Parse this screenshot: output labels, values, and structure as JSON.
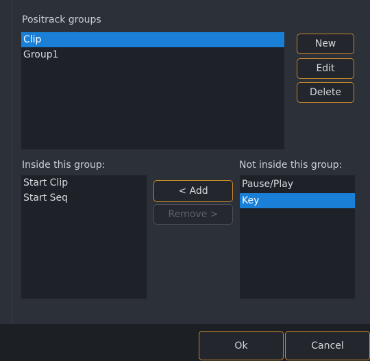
{
  "groups": {
    "label": "Positrack groups",
    "items": [
      "Clip",
      "Group1"
    ],
    "selected_index": 0
  },
  "buttons": {
    "new": "New",
    "edit": "Edit",
    "delete": "Delete",
    "add": "< Add",
    "remove": "Remove >"
  },
  "inside": {
    "label": "Inside this group:",
    "items": [
      "Start Clip",
      "Start Seq"
    ]
  },
  "not_inside": {
    "label": "Not inside this group:",
    "items": [
      "Pause/Play",
      "Key"
    ],
    "selected_index": 1
  },
  "footer": {
    "ok": "Ok",
    "cancel": "Cancel"
  },
  "colors": {
    "accent_border": "#c98a2a",
    "selection": "#1a7fd6"
  }
}
